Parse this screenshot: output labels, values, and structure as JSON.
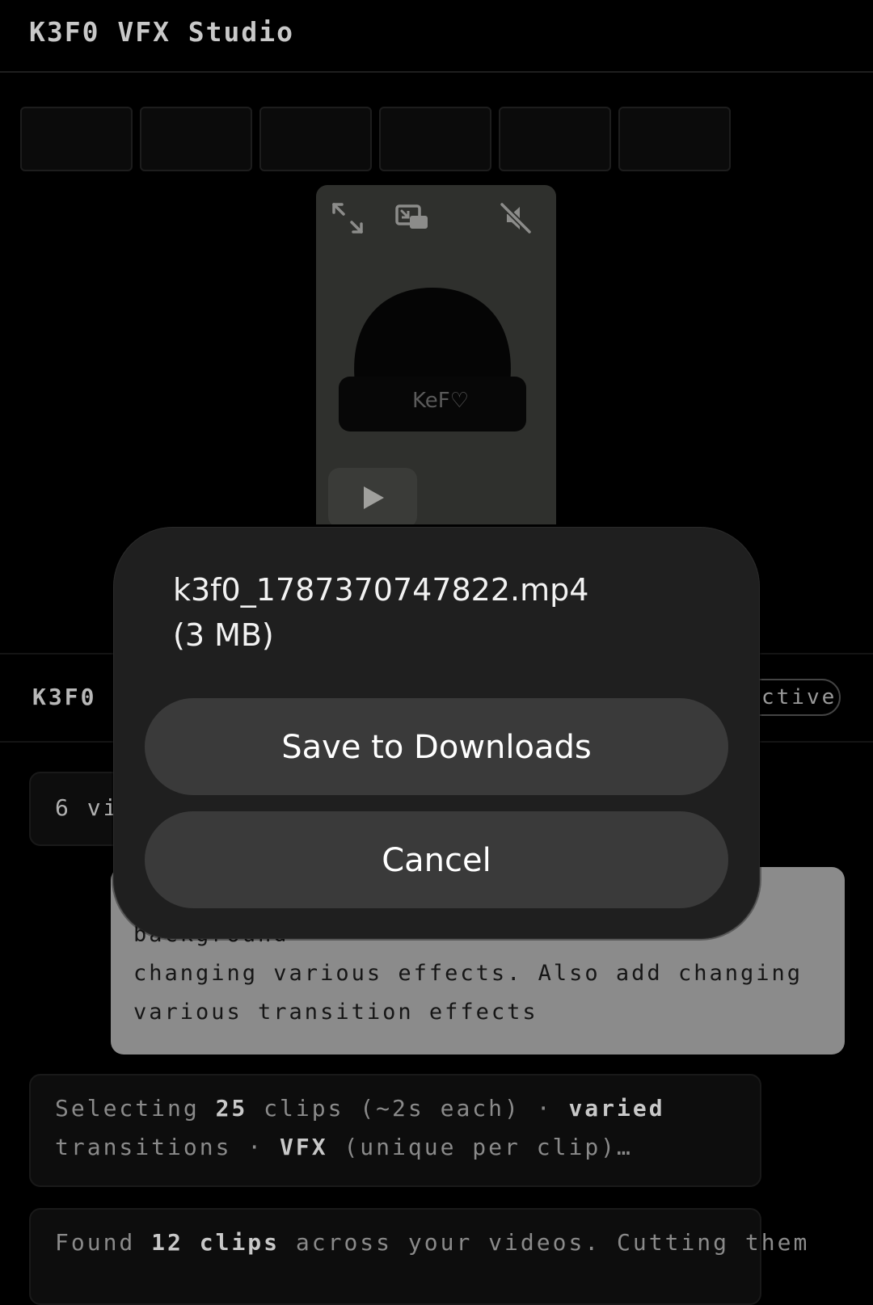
{
  "header": {
    "title": "K3F0 VFX Studio"
  },
  "player": {
    "icons": [
      "expand-icon",
      "picture-in-picture-icon",
      "muted-speaker-icon",
      "play-icon"
    ],
    "hat_text": "KeF♡"
  },
  "panel": {
    "title": "K3F0 V",
    "status": "ctive",
    "video_count": "6 vi"
  },
  "prompt": {
    "text": "apparel. Remove background. Add new background\nchanging various effects. Also add changing\nvarious transition effects"
  },
  "log": [
    {
      "line1": [
        "Selecting ",
        "25",
        " clips (~2s each) · ",
        "varied"
      ],
      "line2": [
        "transitions · ",
        "VFX",
        " (unique per clip)…"
      ]
    },
    {
      "line1": [
        "Found ",
        "12 clips",
        " across your videos. Cutting them"
      ]
    }
  ],
  "dialog": {
    "file_name": "k3f0_1787370747822.mp4",
    "file_size": "(3 MB)",
    "save_label": "Save to Downloads",
    "cancel_label": "Cancel"
  }
}
